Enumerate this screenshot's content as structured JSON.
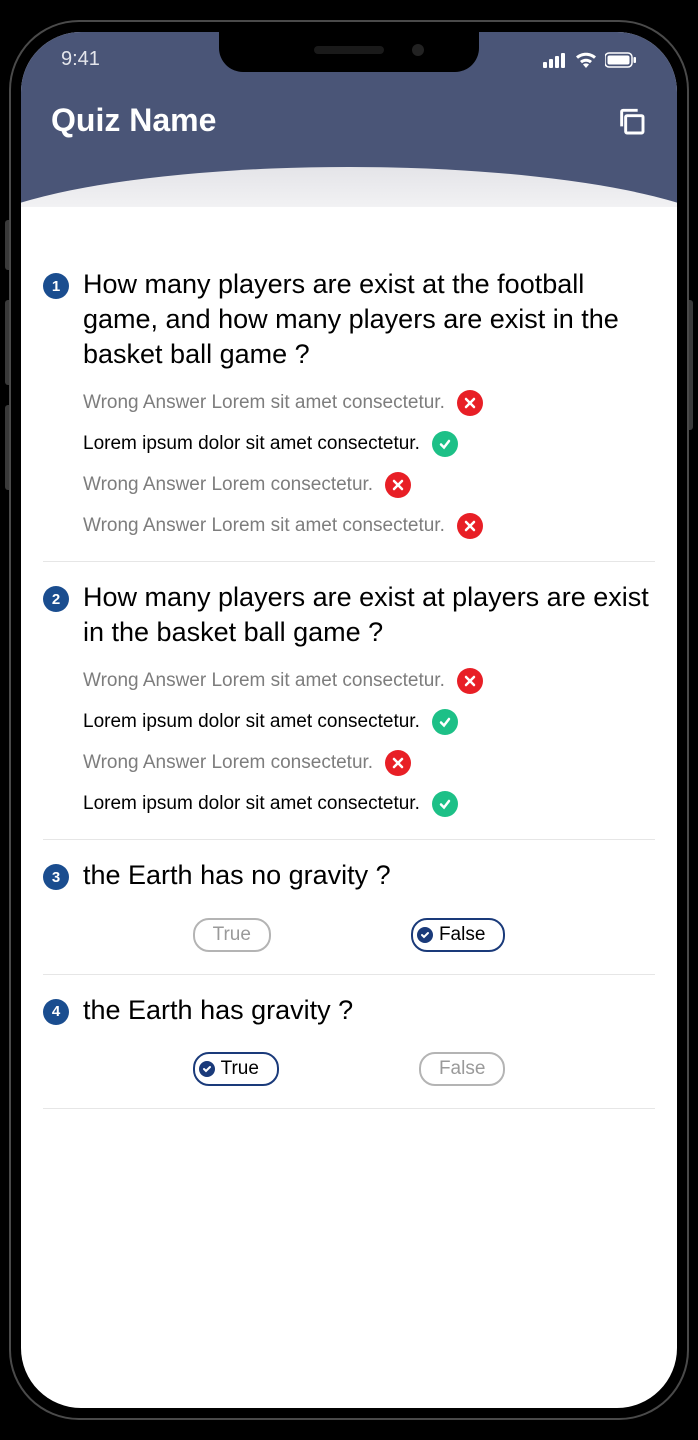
{
  "status": {
    "time": "9:41"
  },
  "header": {
    "title": "Quiz Name"
  },
  "questions": [
    {
      "number": "1",
      "text": "How many players are exist at the football game, and how many  players are exist in the basket ball game ?",
      "type": "mc",
      "answers": [
        {
          "text": "Wrong Answer Lorem sit amet consectetur.",
          "correct": false
        },
        {
          "text": "Lorem ipsum dolor sit amet consectetur.",
          "correct": true
        },
        {
          "text": "Wrong Answer Lorem consectetur.",
          "correct": false
        },
        {
          "text": "Wrong Answer Lorem sit amet consectetur.",
          "correct": false
        }
      ]
    },
    {
      "number": "2",
      "text": "How many players are exist at players are exist in the basket ball game ?",
      "type": "mc",
      "answers": [
        {
          "text": "Wrong Answer Lorem sit amet consectetur.",
          "correct": false
        },
        {
          "text": "Lorem ipsum dolor sit amet consectetur.",
          "correct": true
        },
        {
          "text": "Wrong Answer Lorem consectetur.",
          "correct": false
        },
        {
          "text": "Lorem ipsum dolor sit amet consectetur.",
          "correct": true
        }
      ]
    },
    {
      "number": "3",
      "text": "the Earth has no gravity ?",
      "type": "tf",
      "true_label": "True",
      "false_label": "False",
      "selected": "false"
    },
    {
      "number": "4",
      "text": "the Earth has gravity ?",
      "type": "tf",
      "true_label": "True",
      "false_label": "False",
      "selected": "true"
    }
  ]
}
